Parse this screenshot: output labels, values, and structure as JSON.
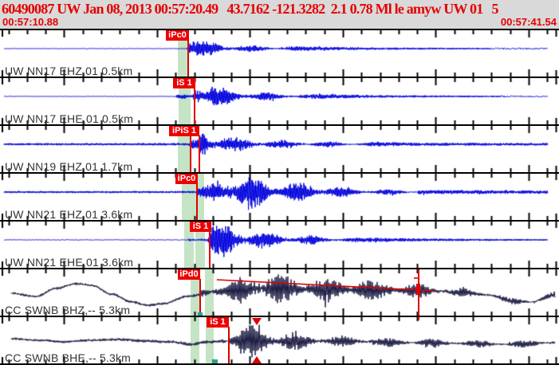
{
  "app": {
    "title_line": "60490087 UW Jan 08, 2013 00:57:20.49   43.7162 -121.3282  2.1 0.78 Ml le amyw UW 01   5",
    "window_start": "00:57:10.88",
    "window_end": "00:57:41.54"
  },
  "event": {
    "event_id": "60490087",
    "network": "UW",
    "origin_time": "Jan 08, 2013 00:57:20.49",
    "latitude": "43.7162",
    "longitude": "-121.3282",
    "depth": "2.1",
    "magnitude_value": "0.78",
    "magnitude_type": "Ml",
    "etype": "le",
    "analyst": "amyw",
    "source": "UW 01",
    "num_stations": "5"
  },
  "colors": {
    "header_text": "#e60000",
    "blue_trace": "#0000dd",
    "dark_trace": "#181840",
    "pick_box": "#ee0000",
    "pick_text": "#ffffff",
    "green_band": "rgba(150,205,150,0.55)",
    "red_line": "#dd0000",
    "teal_mark": "#2f9e8f",
    "station_label": "#333333",
    "panel_bg": "#ffffff",
    "page_bg": "#d9d9d9"
  },
  "chart_data": {
    "type": "seismogram",
    "title": "60490087 UW Jan 08, 2013 00:57:20.49 43.7162 -121.3282 2.1 0.78 Ml le amyw UW 01 5",
    "x_axis": {
      "start_label": "00:57:10.88",
      "end_label": "00:57:41.54",
      "span_seconds": 30.66,
      "tick_interval_seconds": 1,
      "major_tick_every": 5
    },
    "traces": [
      {
        "label": "UW NN17 EHZ,01 0.5km",
        "color_key": "blue_trace",
        "seed": 11,
        "baseline": 23,
        "x_range": [
          5,
          687
        ],
        "step": 0.7,
        "envelope": [
          [
            5,
            0.4
          ],
          [
            234,
            0.4
          ],
          [
            236,
            20
          ],
          [
            243,
            22
          ],
          [
            252,
            13
          ],
          [
            268,
            9
          ],
          [
            295,
            6
          ],
          [
            330,
            4
          ],
          [
            390,
            2.5
          ],
          [
            470,
            1.4
          ],
          [
            687,
            0.8
          ]
        ],
        "wander": [
          [
            5,
            0
          ],
          [
            687,
            0
          ]
        ],
        "picks": [
          {
            "label": "iPc0",
            "box": [
              208,
              29
            ],
            "lines": [
              236
            ],
            "bands": [
              [
                223,
                236
              ]
            ]
          }
        ],
        "marks": []
      },
      {
        "label": "UW NN17 EHE,01 0.5km",
        "color_key": "blue_trace",
        "seed": 22,
        "baseline": 23,
        "x_range": [
          5,
          687
        ],
        "step": 0.7,
        "envelope": [
          [
            5,
            0.3
          ],
          [
            220,
            0.3
          ],
          [
            222,
            2.5
          ],
          [
            242,
            3.5
          ],
          [
            244,
            26
          ],
          [
            258,
            22
          ],
          [
            275,
            14
          ],
          [
            300,
            9
          ],
          [
            340,
            5
          ],
          [
            400,
            3
          ],
          [
            480,
            1.5
          ],
          [
            687,
            0.8
          ]
        ],
        "wander": [
          [
            5,
            0
          ],
          [
            687,
            0
          ]
        ],
        "picks": [
          {
            "label": "iS 1",
            "box": [
              217,
              28
            ],
            "lines": [
              244
            ],
            "bands": [
              [
                224,
                239
              ]
            ]
          }
        ],
        "marks": []
      },
      {
        "label": "UW NN19 EHZ,01 1.7km",
        "color_key": "blue_trace",
        "seed": 33,
        "baseline": 23,
        "x_range": [
          5,
          687
        ],
        "step": 0.7,
        "envelope": [
          [
            5,
            1.3
          ],
          [
            237,
            1.5
          ],
          [
            239,
            6
          ],
          [
            249,
            7
          ],
          [
            251,
            26
          ],
          [
            265,
            18
          ],
          [
            285,
            12
          ],
          [
            315,
            8
          ],
          [
            360,
            5.5
          ],
          [
            430,
            3.5
          ],
          [
            520,
            2
          ],
          [
            687,
            1.5
          ]
        ],
        "wander": [
          [
            5,
            0
          ],
          [
            687,
            0
          ]
        ],
        "picks": [
          {
            "label": "iPiS 1",
            "box": [
              212,
              38
            ],
            "lines": [
              239,
              250
            ],
            "bands": [
              [
                223,
                240
              ]
            ]
          }
        ],
        "marks": []
      },
      {
        "label": "UW NN21 EHZ,01 3.6km",
        "color_key": "blue_trace",
        "seed": 44,
        "baseline": 23,
        "x_range": [
          5,
          687
        ],
        "step": 0.7,
        "envelope": [
          [
            5,
            1.3
          ],
          [
            245,
            1.3
          ],
          [
            247,
            7
          ],
          [
            265,
            12
          ],
          [
            283,
            26
          ],
          [
            320,
            24
          ],
          [
            355,
            16
          ],
          [
            400,
            10
          ],
          [
            460,
            5
          ],
          [
            540,
            2.5
          ],
          [
            687,
            2
          ]
        ],
        "wander": [
          [
            5,
            0
          ],
          [
            687,
            0
          ]
        ],
        "picks": [
          {
            "label": "iPc0",
            "box": [
              220,
              28
            ],
            "lines": [
              247
            ],
            "bands": [
              [
                228,
                256
              ]
            ]
          }
        ],
        "marks": []
      },
      {
        "label": "UW NN21 EHE,01 3.6km",
        "color_key": "blue_trace",
        "seed": 55,
        "baseline": 23,
        "x_range": [
          5,
          687
        ],
        "step": 0.7,
        "envelope": [
          [
            5,
            0.4
          ],
          [
            236,
            0.4
          ],
          [
            238,
            3.5
          ],
          [
            261,
            5
          ],
          [
            263,
            28
          ],
          [
            290,
            23
          ],
          [
            318,
            15
          ],
          [
            355,
            9
          ],
          [
            410,
            5
          ],
          [
            470,
            2.5
          ],
          [
            560,
            1.5
          ],
          [
            687,
            1
          ]
        ],
        "wander": [
          [
            5,
            0
          ],
          [
            687,
            0
          ]
        ],
        "picks": [
          {
            "label": "iS 1",
            "box": [
              238,
              27
            ],
            "lines": [
              263
            ],
            "bands": [
              [
                231,
                243
              ],
              [
                245,
                257
              ]
            ]
          }
        ],
        "marks": []
      },
      {
        "label": "CC SWNB BHZ,-- 5.3km",
        "color_key": "dark_trace",
        "seed": 66,
        "baseline": 31,
        "x_range": [
          14,
          696
        ],
        "step": 1.0,
        "envelope": [
          [
            14,
            1.6
          ],
          [
            249,
            1.8
          ],
          [
            251,
            9
          ],
          [
            275,
            14
          ],
          [
            300,
            20
          ],
          [
            345,
            22
          ],
          [
            400,
            19
          ],
          [
            450,
            17
          ],
          [
            500,
            13
          ],
          [
            530,
            10
          ],
          [
            555,
            7
          ],
          [
            610,
            5
          ],
          [
            696,
            4.5
          ]
        ],
        "wander": [
          [
            14,
            -1
          ],
          [
            45,
            3
          ],
          [
            70,
            -7
          ],
          [
            95,
            -13
          ],
          [
            115,
            -11
          ],
          [
            140,
            0
          ],
          [
            165,
            10
          ],
          [
            185,
            14
          ],
          [
            205,
            12
          ],
          [
            235,
            3
          ],
          [
            265,
            -3
          ],
          [
            320,
            -7
          ],
          [
            390,
            -6
          ],
          [
            470,
            -5
          ],
          [
            540,
            -4
          ],
          [
            580,
            -2
          ],
          [
            610,
            1
          ],
          [
            645,
            9
          ],
          [
            665,
            10
          ],
          [
            696,
            1
          ]
        ],
        "picks": [
          {
            "label": "iPd0",
            "box": [
              223,
              28
            ],
            "lines": [
              251
            ],
            "bands": [
              [
                239,
                250
              ],
              [
                257,
                268
              ]
            ]
          }
        ],
        "marks": [
          {
            "type": "line",
            "name": "coda-envelope-line",
            "x1": 272,
            "y1": 13,
            "x2": 545,
            "y2": 27,
            "color_key": "red_line"
          },
          {
            "type": "vline",
            "name": "coda-cursor-line",
            "x": 525,
            "y1": 0,
            "y2": 58,
            "color_key": "red_line"
          },
          {
            "type": "line",
            "name": "coda-cursor-tick",
            "x1": 519,
            "y1": 11,
            "x2": 526,
            "y2": 11,
            "color_key": "red_line"
          },
          {
            "type": "rect",
            "name": "coda-cursor-handle",
            "x": 522,
            "y": 18,
            "w": 5,
            "h": 14,
            "color_key": "red_line"
          },
          {
            "type": "rect",
            "name": "coda-duration-mark",
            "x": 248,
            "y": 54,
            "w": 6,
            "h": 4,
            "color_key": "teal_mark"
          }
        ]
      },
      {
        "label": "CC SWNB BHE,-- 5.3km",
        "color_key": "dark_trace",
        "seed": 77,
        "baseline": 30,
        "x_range": [
          14,
          696
        ],
        "step": 1.0,
        "envelope": [
          [
            14,
            1.6
          ],
          [
            230,
            2
          ],
          [
            283,
            2.2
          ],
          [
            286,
            6
          ],
          [
            289,
            26
          ],
          [
            310,
            28
          ],
          [
            335,
            19
          ],
          [
            365,
            13
          ],
          [
            405,
            9
          ],
          [
            455,
            7
          ],
          [
            520,
            6
          ],
          [
            600,
            5.5
          ],
          [
            696,
            5
          ]
        ],
        "wander": [
          [
            14,
            -3
          ],
          [
            50,
            -1
          ],
          [
            80,
            1
          ],
          [
            110,
            -1
          ],
          [
            150,
            -2
          ],
          [
            185,
            0
          ],
          [
            215,
            1
          ],
          [
            240,
            4
          ],
          [
            260,
            1
          ],
          [
            290,
            0
          ],
          [
            420,
            0
          ],
          [
            520,
            2
          ],
          [
            580,
            3
          ],
          [
            640,
            4
          ],
          [
            696,
            2
          ]
        ],
        "picks": [
          {
            "label": "iS 1",
            "box": [
              259,
              28
            ],
            "lines": [
              287
            ],
            "bands": [
              [
                239,
                250
              ],
              [
                258,
                268
              ]
            ]
          }
        ],
        "marks": [
          {
            "type": "vline",
            "name": "coda-cursor-tick-top",
            "x": 525,
            "y1": 0,
            "y2": 4,
            "color_key": "red_line"
          },
          {
            "type": "tridown",
            "name": "scroll-marker-down",
            "x": 322,
            "y": 1,
            "color_key": "red_line"
          },
          {
            "type": "triup",
            "name": "scroll-marker-up",
            "x": 322,
            "y": 58,
            "color_key": "red_line"
          },
          {
            "type": "rect",
            "name": "coda-duration-mark",
            "x": 266,
            "y": 53,
            "w": 7,
            "h": 5,
            "color_key": "teal_mark"
          }
        ]
      }
    ]
  }
}
